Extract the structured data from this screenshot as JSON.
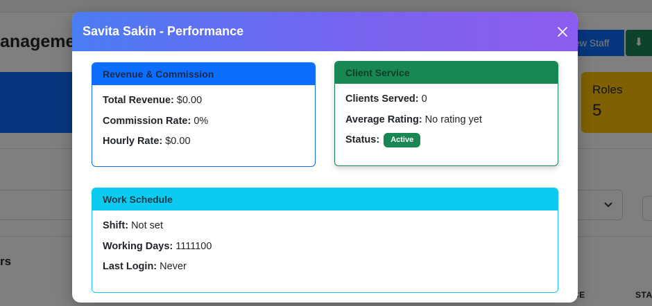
{
  "background": {
    "page_title": "anagemen",
    "new_staff_button": "ew Staff",
    "download_icon": "download-icon",
    "roles_label": "Roles",
    "roles_value": "5",
    "table_heading": "rs",
    "columns": [
      "CE",
      "STA"
    ]
  },
  "modal": {
    "title": "Savita Sakin - Performance",
    "close_icon": "close-icon",
    "revenue_card": {
      "title": "Revenue & Commission",
      "rows": [
        {
          "label": "Total Revenue:",
          "value": " $0.00"
        },
        {
          "label": "Commission Rate:",
          "value": " 0%"
        },
        {
          "label": "Hourly Rate:",
          "value": " $0.00"
        }
      ]
    },
    "client_card": {
      "title": "Client Service",
      "rows": [
        {
          "label": "Clients Served:",
          "value": " 0"
        },
        {
          "label": "Average Rating:",
          "value": " No rating yet"
        }
      ],
      "status_label": "Status:",
      "status_badge": "Active"
    },
    "schedule_card": {
      "title": "Work Schedule",
      "rows": [
        {
          "label": "Shift:",
          "value": " Not set"
        },
        {
          "label": "Working Days:",
          "value": " 1111100"
        },
        {
          "label": "Last Login:",
          "value": " Never"
        }
      ]
    }
  },
  "colors": {
    "primary": "#0d6efd",
    "success": "#198754",
    "info": "#0dcaf0",
    "warning": "#ffc107",
    "header_gradient_start": "#4a7cf2",
    "header_gradient_end": "#8d5cf0"
  }
}
